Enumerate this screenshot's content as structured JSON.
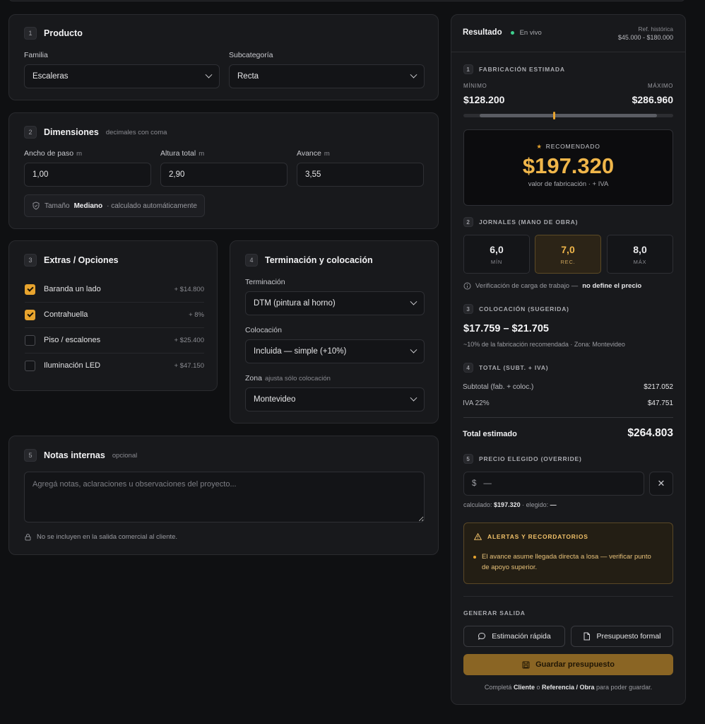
{
  "producto": {
    "num": "1",
    "title": "Producto",
    "familia_label": "Familia",
    "familia_value": "Escaleras",
    "subcat_label": "Subcategoría",
    "subcat_value": "Recta"
  },
  "dimensiones": {
    "num": "2",
    "title": "Dimensiones",
    "hint": "decimales con coma",
    "fields": [
      {
        "label": "Ancho de paso",
        "unit": "m",
        "value": "1,00"
      },
      {
        "label": "Altura total",
        "unit": "m",
        "value": "2,90"
      },
      {
        "label": "Avance",
        "unit": "m",
        "value": "3,55"
      }
    ],
    "size_prefix": "Tamaño",
    "size_value": "Mediano",
    "size_suffix": "· calculado automáticamente"
  },
  "extras": {
    "num": "3",
    "title": "Extras / Opciones",
    "items": [
      {
        "label": "Baranda un lado",
        "price": "+ $14.800",
        "checked": true
      },
      {
        "label": "Contrahuella",
        "price": "+ 8%",
        "checked": true
      },
      {
        "label": "Piso / escalones",
        "price": "+ $25.400",
        "checked": false
      },
      {
        "label": "Iluminación LED",
        "price": "+ $47.150",
        "checked": false
      }
    ]
  },
  "terminacion": {
    "num": "4",
    "title": "Terminación y colocación",
    "term_label": "Terminación",
    "term_value": "DTM (pintura al horno)",
    "coloc_label": "Colocación",
    "coloc_value": "Incluida — simple (+10%)",
    "zona_label": "Zona",
    "zona_hint": "ajusta sólo colocación",
    "zona_value": "Montevideo"
  },
  "notas": {
    "num": "5",
    "title": "Notas internas",
    "hint": "opcional",
    "placeholder": "Agregá notas, aclaraciones u observaciones del proyecto...",
    "footer": "No se incluyen en la salida comercial al cliente."
  },
  "resultado": {
    "title": "Resultado",
    "live": "En vivo",
    "ref_label": "Ref. histórica",
    "ref_value": "$45.000 - $180.000",
    "fab": {
      "num": "1",
      "label": "FABRICACIÓN ESTIMADA",
      "min_label": "MÍNIMO",
      "min_value": "$128.200",
      "max_label": "MÁXIMO",
      "max_value": "$286.960",
      "marker_fraction": 0.434,
      "rec_label": "RECOMENDADO",
      "rec_value": "$197.320",
      "rec_sub": "valor de fabricación · + IVA"
    },
    "jornales": {
      "num": "2",
      "label": "JORNALES (MANO DE OBRA)",
      "boxes": [
        {
          "value": "6,0",
          "key": "MÍN"
        },
        {
          "value": "7,0",
          "key": "REC."
        },
        {
          "value": "8,0",
          "key": "MÁX"
        }
      ],
      "note": "Verificación de carga de trabajo —",
      "note_bold": "no define el precio"
    },
    "colocacion": {
      "num": "3",
      "label": "COLOCACIÓN (SUGERIDA)",
      "range": "$17.759 – $21.705",
      "sub": "~10% de la fabricación recomendada · Zona: Montevideo"
    },
    "total": {
      "num": "4",
      "label": "TOTAL (SUBT. + IVA)",
      "subtotal_label": "Subtotal (fab. + coloc.)",
      "subtotal_value": "$217.052",
      "iva_label": "IVA 22%",
      "iva_value": "$47.751",
      "total_label": "Total estimado",
      "total_value": "$264.803"
    },
    "override": {
      "num": "5",
      "label": "PRECIO ELEGIDO (OVERRIDE)",
      "currency": "$",
      "input_value": "—",
      "calc_label": "calculado:",
      "calc_value": "$197.320",
      "chosen_label": "· elegido:",
      "chosen_value": "—"
    },
    "alertas": {
      "title": "ALERTAS Y RECORDATORIOS",
      "items": [
        "El avance asume llegada directa a losa — verificar punto de apoyo superior."
      ]
    },
    "salida": {
      "label": "GENERAR SALIDA",
      "quick": "Estimación rápida",
      "formal": "Presupuesto formal",
      "save": "Guardar presupuesto",
      "foot_pre": "Completá",
      "foot_cliente": "Cliente",
      "foot_o": "o",
      "foot_ref": "Referencia / Obra",
      "foot_post": "para poder guardar."
    }
  },
  "colors": {
    "accent": "#e8a42e",
    "live": "#3ecf8e",
    "panel": "#18191c",
    "bg": "#0f1012"
  }
}
